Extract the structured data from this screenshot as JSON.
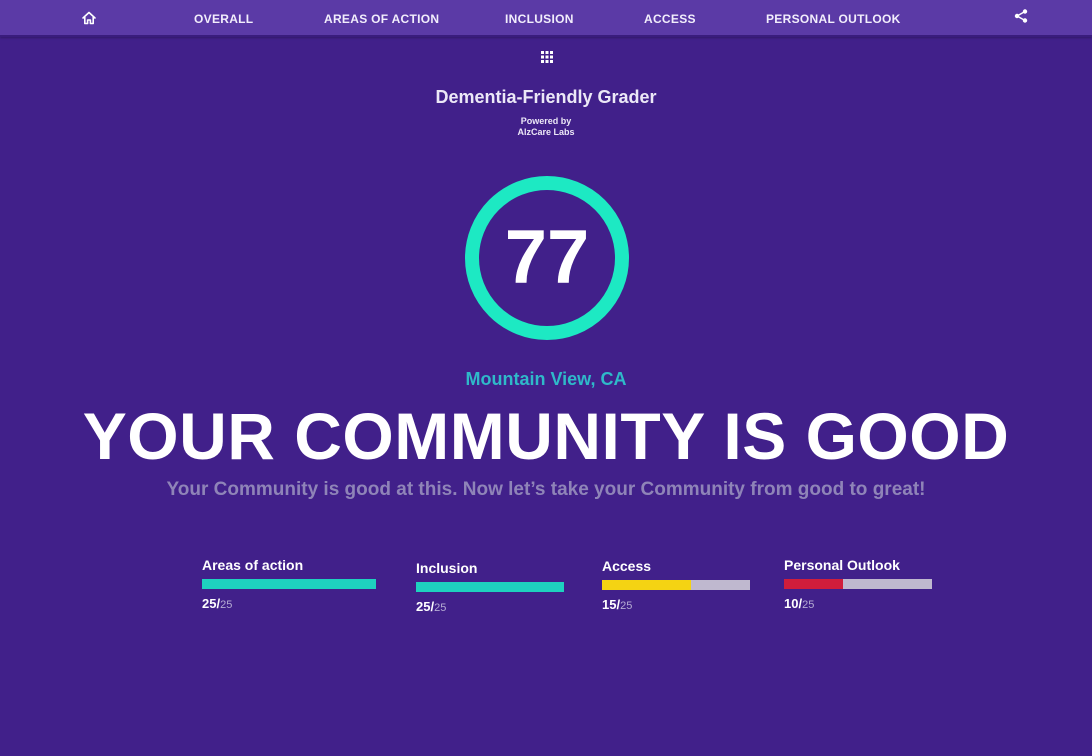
{
  "nav": {
    "home_icon": "home-icon",
    "items": [
      "OVERALL",
      "AREAS OF ACTION",
      "INCLUSION",
      "ACCESS",
      "PERSONAL OUTLOOK"
    ],
    "share_icon": "share-icon"
  },
  "apps_icon": "grid-icon",
  "header": {
    "title": "Dementia-Friendly Grader",
    "powered_line1": "Powered by",
    "powered_line2": "AlzCare Labs"
  },
  "score": {
    "value": "77",
    "ring_color": "#1de9c3"
  },
  "location": "Mountain View, CA",
  "headline": "YOUR COMMUNITY IS GOOD",
  "subline": "Your Community is good at this. Now let’s take your Community from good to great!",
  "metrics": [
    {
      "label": "Areas of action",
      "score": "25/",
      "max": "25",
      "fraction": 1.0,
      "color": "#1ed1bf"
    },
    {
      "label": "Inclusion",
      "score": "25/",
      "max": "25",
      "fraction": 1.0,
      "color": "#1ed1bf"
    },
    {
      "label": "Access",
      "score": "15/",
      "max": "25",
      "fraction": 0.6,
      "color": "#f4d313"
    },
    {
      "label": "Personal Outlook",
      "score": "10/",
      "max": "25",
      "fraction": 0.4,
      "color": "#d01d3b"
    }
  ],
  "colors": {
    "background": "#41208a",
    "topbar": "#5b3aa6",
    "location": "#2fb9c9",
    "bar_track": "#bfb8cf"
  }
}
